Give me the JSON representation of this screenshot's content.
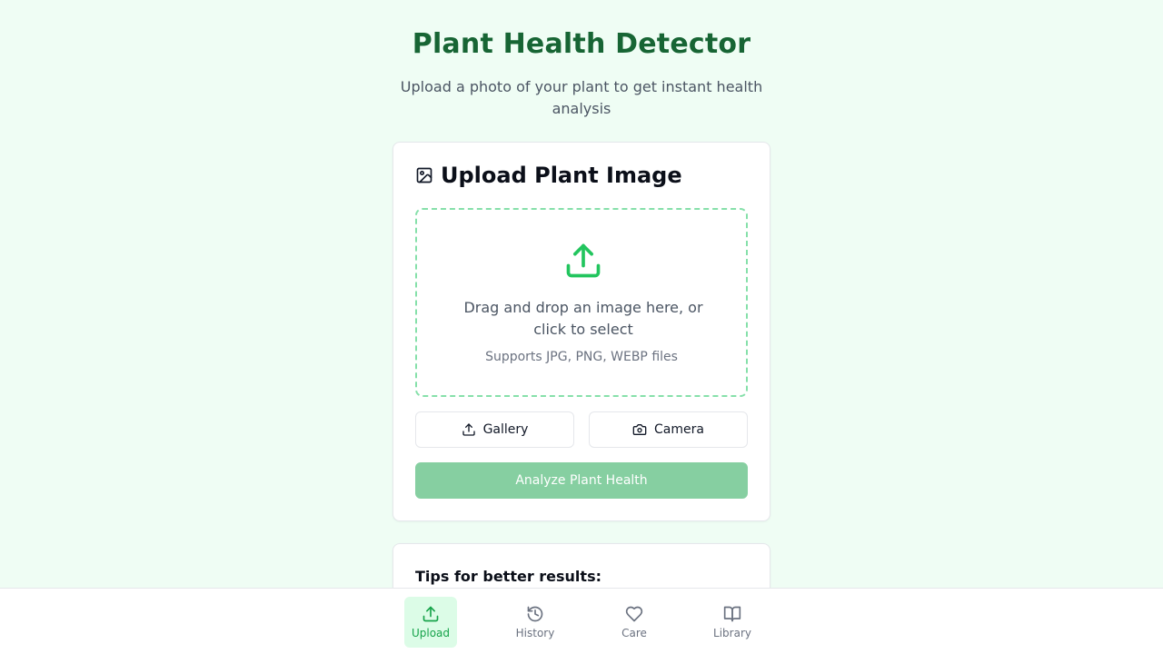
{
  "header": {
    "title": "Plant Health Detector",
    "subtitle": "Upload a photo of your plant to get instant health analysis"
  },
  "upload_card": {
    "title": "Upload Plant Image",
    "title_icon": "image-icon",
    "dropzone": {
      "icon": "upload-icon",
      "main_text": "Drag and drop an image here, or click to select",
      "sub_text": "Supports JPG, PNG, WEBP files"
    },
    "buttons": {
      "gallery": {
        "label": "Gallery",
        "icon": "upload-icon"
      },
      "camera": {
        "label": "Camera",
        "icon": "camera-icon"
      }
    },
    "analyze_label": "Analyze Plant Health"
  },
  "tips_card": {
    "title": "Tips for better results:"
  },
  "bottom_nav": {
    "items": [
      {
        "label": "Upload",
        "icon": "upload-icon",
        "active": true
      },
      {
        "label": "History",
        "icon": "history-icon",
        "active": false
      },
      {
        "label": "Care",
        "icon": "heart-icon",
        "active": false
      },
      {
        "label": "Library",
        "icon": "book-open-icon",
        "active": false
      }
    ]
  },
  "colors": {
    "background": "#effdf4",
    "title": "#176534",
    "accent": "#22c55e",
    "dropzone_border": "#86e0aa",
    "analyze_disabled": "#86cfa1",
    "nav_active_bg": "#dcfce7"
  }
}
